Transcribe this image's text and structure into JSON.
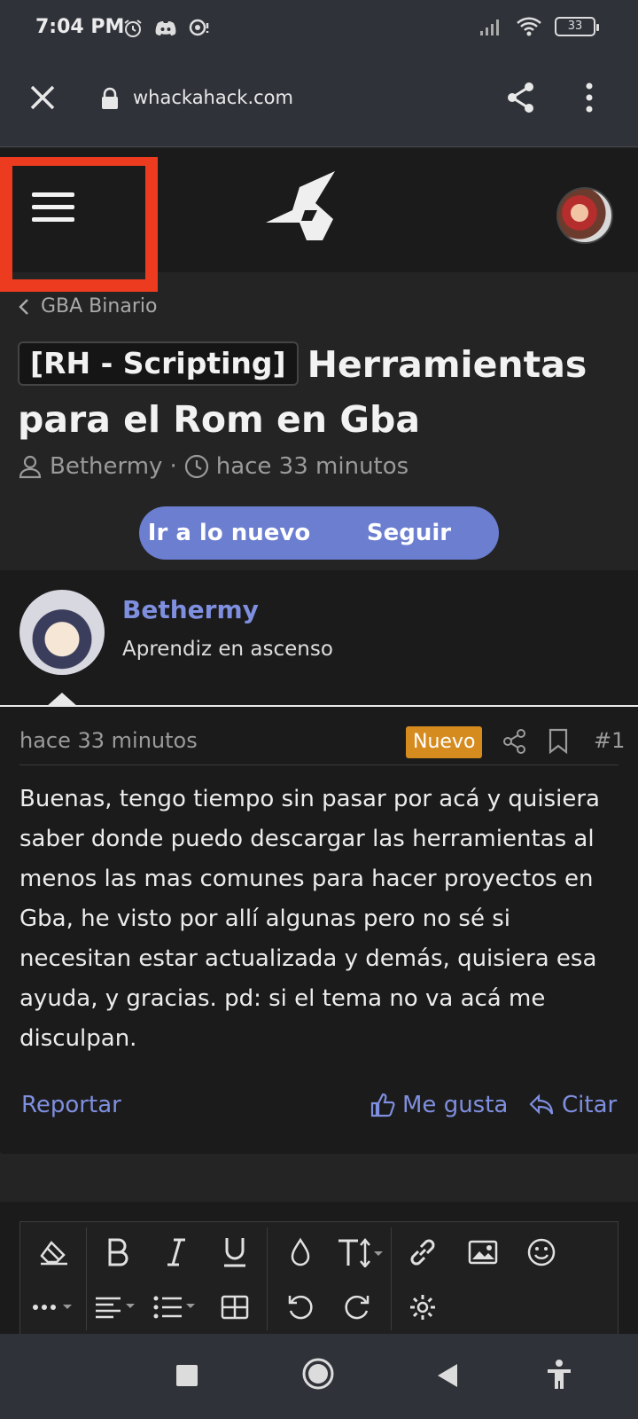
{
  "status_bar": {
    "time": "7:04 PM",
    "battery": "33"
  },
  "browser": {
    "url": "whackahack.com"
  },
  "breadcrumb": {
    "label": "GBA Binario"
  },
  "thread": {
    "prefix": "[RH - Scripting]",
    "title": "Herramientas para el Rom en Gba",
    "author": "Bethermy",
    "separator": "·",
    "time": "hace 33 minutos"
  },
  "buttons": {
    "go_new": "Ir a lo nuevo",
    "follow": "Seguir"
  },
  "post": {
    "username": "Bethermy",
    "user_title": "Aprendiz en ascenso",
    "time": "hace 33 minutos",
    "badge": "Nuevo",
    "number": "#1",
    "body": "Buenas, tengo tiempo sin pasar por acá y quisiera saber donde puedo descargar las herramientas al menos las mas comunes para hacer proyectos en Gba, he visto por allí algunas pero no sé si necesitan estar actualizada y demás, quisiera esa ayuda, y gracias. pd: si el tema no va acá me disculpan.",
    "report": "Reportar",
    "like": "Me gusta",
    "quote": "Citar"
  },
  "colors": {
    "accent": "#6b7ed0",
    "link": "#7f8fdf",
    "badge": "#d68b1f",
    "highlight_box": "#ec3b1f"
  }
}
